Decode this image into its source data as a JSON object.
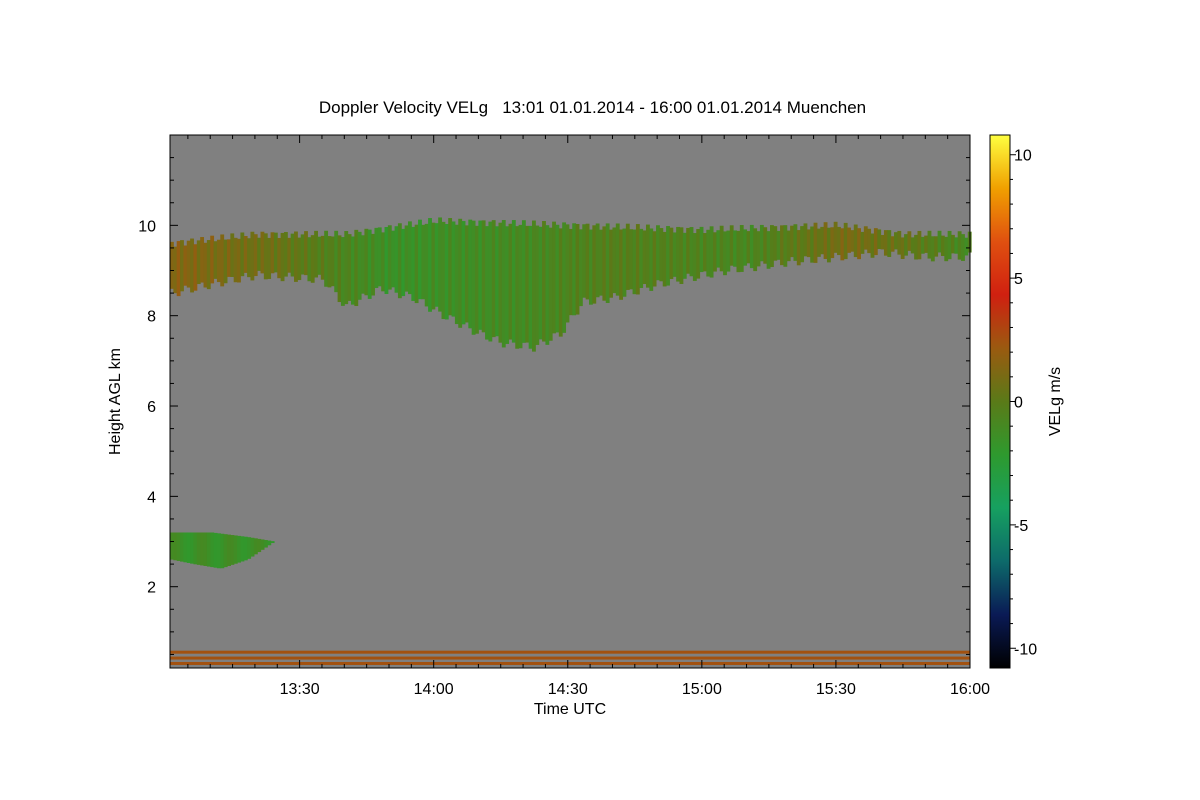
{
  "chart_data": {
    "type": "heatmap",
    "title": "Doppler Velocity VELg   13:01 01.01.2014 - 16:00 01.01.2014 Muenchen",
    "xlabel": "Time UTC",
    "ylabel": "Height AGL km",
    "colorbar_label": "VELg m/s",
    "x_ticks": [
      "13:30",
      "14:00",
      "14:30",
      "15:00",
      "15:30",
      "16:00"
    ],
    "x_tick_minutes": [
      30,
      60,
      90,
      120,
      150,
      180
    ],
    "x_range_minutes": [
      1,
      180
    ],
    "y_ticks": [
      2,
      4,
      6,
      8,
      10
    ],
    "y_range": [
      0.2,
      12.0
    ],
    "colorbar_ticks": [
      10,
      5,
      0,
      -5,
      -10
    ],
    "colorbar_range": [
      -10.8,
      10.8
    ],
    "background_color": "#808080",
    "colormap": [
      "#000000",
      "#0a1a55",
      "#0d6a6a",
      "#16a060",
      "#2e9a2e",
      "#5a7a18",
      "#9a5a10",
      "#d02010",
      "#e05010",
      "#f0a000",
      "#ffff40"
    ],
    "cirrus_layer": {
      "top_km": [
        [
          1,
          9.6
        ],
        [
          20,
          9.8
        ],
        [
          40,
          9.8
        ],
        [
          60,
          10.1
        ],
        [
          90,
          10.0
        ],
        [
          120,
          9.9
        ],
        [
          150,
          10.0
        ],
        [
          165,
          9.8
        ],
        [
          180,
          9.8
        ]
      ],
      "bottom_km": [
        [
          1,
          8.5
        ],
        [
          10,
          8.7
        ],
        [
          20,
          8.9
        ],
        [
          35,
          8.8
        ],
        [
          40,
          8.2
        ],
        [
          48,
          8.6
        ],
        [
          55,
          8.4
        ],
        [
          62,
          8.0
        ],
        [
          70,
          7.6
        ],
        [
          75,
          7.4
        ],
        [
          82,
          7.3
        ],
        [
          88,
          7.6
        ],
        [
          93,
          8.3
        ],
        [
          100,
          8.4
        ],
        [
          110,
          8.7
        ],
        [
          125,
          9.0
        ],
        [
          140,
          9.2
        ],
        [
          150,
          9.3
        ],
        [
          160,
          9.4
        ],
        [
          170,
          9.3
        ],
        [
          180,
          9.3
        ]
      ],
      "velocity_ms": [
        [
          1,
          1.5
        ],
        [
          25,
          0.5
        ],
        [
          50,
          -1.5
        ],
        [
          80,
          -1.0
        ],
        [
          100,
          -0.3
        ],
        [
          130,
          -0.8
        ],
        [
          152,
          1.0
        ],
        [
          165,
          0.3
        ],
        [
          180,
          -1.0
        ]
      ]
    },
    "low_cloud": {
      "top_km": [
        [
          1,
          3.2
        ],
        [
          10,
          3.2
        ],
        [
          18,
          3.1
        ],
        [
          24,
          3.0
        ]
      ],
      "bottom_km": [
        [
          1,
          2.6
        ],
        [
          6,
          2.5
        ],
        [
          12,
          2.4
        ],
        [
          18,
          2.6
        ],
        [
          24,
          3.0
        ]
      ],
      "velocity_ms": -1.5
    },
    "near_surface_lines_km": [
      0.3,
      0.42,
      0.55
    ],
    "near_surface_velocity_ms": 2.5
  }
}
